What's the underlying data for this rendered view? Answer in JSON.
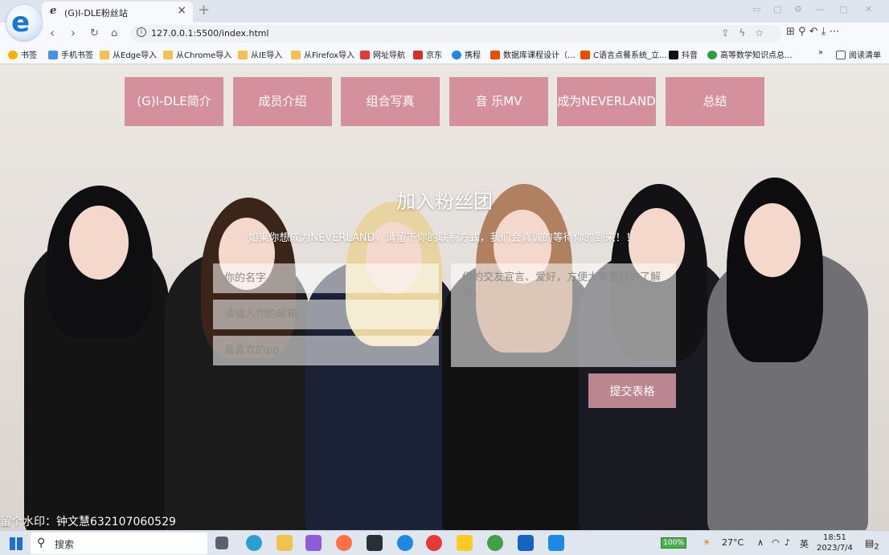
{
  "browser": {
    "tab_title": "(G)I-DLE粉丝站",
    "url": "127.0.0.1:5500/index.html",
    "bookmarks": [
      "书签",
      "手机书签",
      "从Edge导入",
      "从Chrome导入",
      "从IE导入",
      "从Firefox导入",
      "网址导航",
      "京东",
      "携程",
      "数据库课程设计（...",
      "C语言点餐系统_立...",
      "抖音",
      "高等数学知识点总..."
    ],
    "reading_list": "阅读清单"
  },
  "nav": {
    "items": [
      "(G)I-DLE简介",
      "成员介绍",
      "组合写真",
      "音 乐MV",
      "成为NEVERLAND",
      "总结"
    ]
  },
  "form": {
    "title": "加入粉丝团",
    "subtitle": "如果你想成为NEVERLAND，请留下你的联系方式，我们会真诚的等待你的到来！！",
    "name_placeholder": "你的名字",
    "email_placeholder": "请输入你的邮箱",
    "fav_placeholder": "最喜欢的pp",
    "message_placeholder": "你的交友宣言、爱好，方便大家更好的了解你。",
    "submit_label": "提交表格"
  },
  "watermark": "留个水印：钟文慧632107060529",
  "taskbar": {
    "search_label": "搜索",
    "battery": "100%",
    "weather": "27°C",
    "ime": "英",
    "time": "18:51",
    "date": "2023/7/4",
    "notification_count": "2"
  },
  "colors": {
    "nav_button": "#d4919d",
    "submit_button": "#bb8690"
  }
}
